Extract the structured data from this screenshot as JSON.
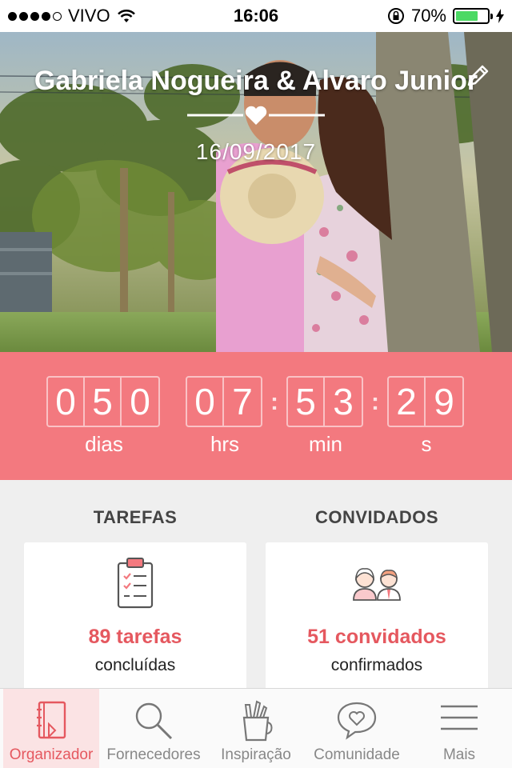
{
  "status_bar": {
    "carrier": "VIVO",
    "time": "16:06",
    "battery_percent": "70%",
    "battery_level": 0.7,
    "signal_bars_filled": 4,
    "signal_bars_total": 5
  },
  "hero": {
    "title": "Gabriela Nogueira & Alvaro Junior",
    "date": "16/09/2017",
    "edit_icon": "pencil-icon"
  },
  "countdown": {
    "days": [
      "0",
      "5",
      "0"
    ],
    "hours": [
      "0",
      "7"
    ],
    "minutes": [
      "5",
      "3"
    ],
    "seconds": [
      "2",
      "9"
    ],
    "labels": {
      "days": "dias",
      "hours": "hrs",
      "minutes": "min",
      "seconds": "s"
    }
  },
  "summary": {
    "tasks": {
      "title": "TAREFAS",
      "count": "89 tarefas",
      "sub": "concluídas",
      "icon": "clipboard-icon"
    },
    "guests": {
      "title": "CONVIDADOS",
      "count": "51 convidados",
      "sub": "confirmados",
      "icon": "couple-icon"
    }
  },
  "tabs": [
    {
      "label": "Organizador",
      "icon": "notebook-icon",
      "active": true
    },
    {
      "label": "Fornecedores",
      "icon": "search-icon",
      "active": false
    },
    {
      "label": "Inspiração",
      "icon": "pencil-cup-icon",
      "active": false
    },
    {
      "label": "Comunidade",
      "icon": "chat-heart-icon",
      "active": false
    },
    {
      "label": "Mais",
      "icon": "menu-icon",
      "active": false
    }
  ],
  "colors": {
    "accent": "#f3797f",
    "accent_text": "#e5585f",
    "active_tab_bg": "#fbe3e4",
    "battery": "#4cd964"
  }
}
